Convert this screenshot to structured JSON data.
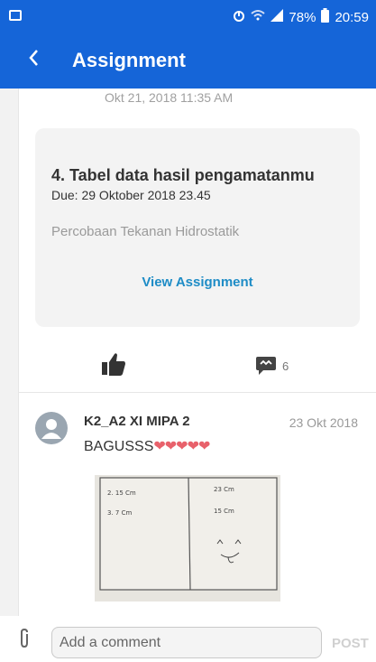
{
  "status_bar": {
    "battery": "78%",
    "time": "20:59"
  },
  "app_bar": {
    "title": "Assignment"
  },
  "post": {
    "timestamp": "Okt 21, 2018 11:35 AM"
  },
  "assignment_card": {
    "title": "4. Tabel data hasil pengamatanmu",
    "due": "Due: 29 Oktober 2018 23.45",
    "subject": "Percobaan Tekanan Hidrostatik",
    "view_label": "View Assignment"
  },
  "actions": {
    "comment_count": "6"
  },
  "comment": {
    "author": "K2_A2 XI MIPA 2",
    "date": "23 Okt 2018",
    "text": "BAGUSSS",
    "emoji": "❤❤❤❤❤",
    "photo_notes": {
      "left_1": "2.  15  Cm",
      "left_2": "3.  7  Cm",
      "right_1": "23  Cm",
      "right_2": "15  Cm"
    }
  },
  "composer": {
    "placeholder": "Add a comment",
    "post_label": "POST"
  },
  "colors": {
    "primary": "#1565d8",
    "link": "#1e8cc6"
  }
}
